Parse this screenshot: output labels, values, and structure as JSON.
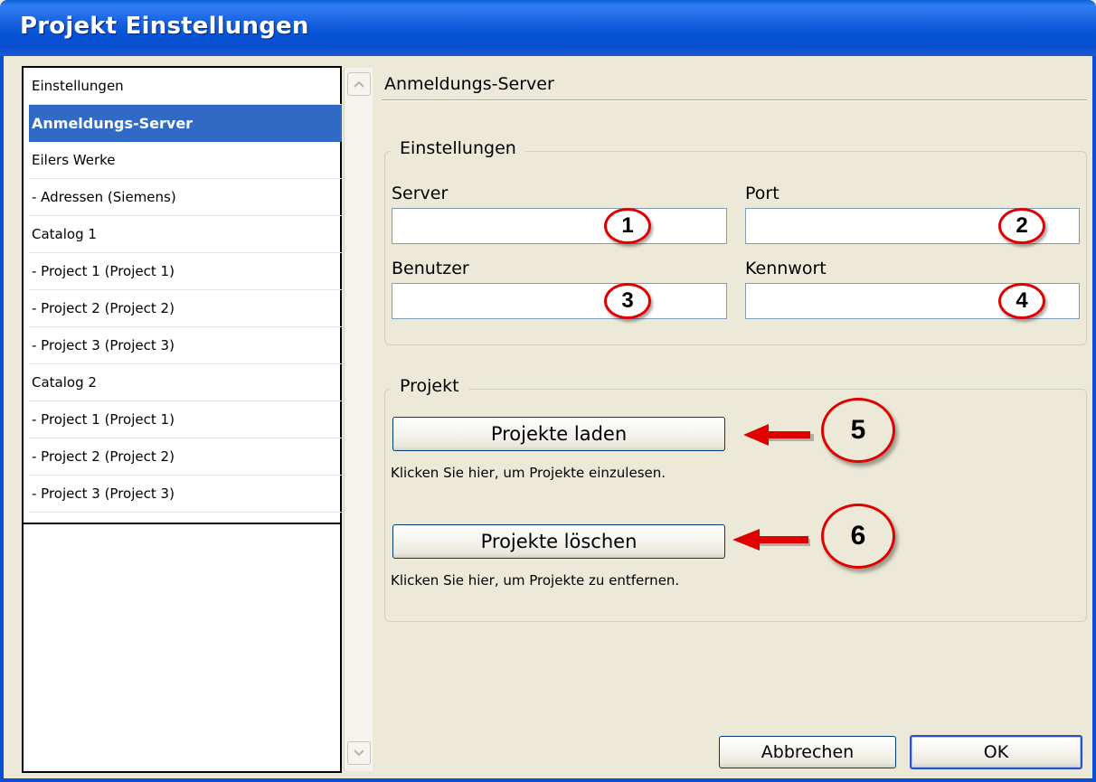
{
  "window": {
    "title": "Projekt Einstellungen"
  },
  "nav": {
    "items": [
      {
        "label": "Einstellungen"
      },
      {
        "label": "Anmeldungs-Server",
        "selected": true
      },
      {
        "label": "Eilers Werke"
      },
      {
        "label": " - Adressen (Siemens)"
      },
      {
        "label": "Catalog 1"
      },
      {
        "label": " - Project 1 (Project 1)"
      },
      {
        "label": " - Project 2 (Project 2)"
      },
      {
        "label": " - Project 3 (Project 3)"
      },
      {
        "label": "Catalog 2"
      },
      {
        "label": " - Project 1 (Project 1)"
      },
      {
        "label": " - Project 2 (Project 2)"
      },
      {
        "label": " - Project 3 (Project 3)"
      }
    ]
  },
  "page": {
    "title": "Anmeldungs-Server",
    "settings_group": {
      "legend": "Einstellungen",
      "server": {
        "label": "Server",
        "value": "",
        "marker": "1"
      },
      "port": {
        "label": "Port",
        "value": "",
        "marker": "2"
      },
      "user": {
        "label": "Benutzer",
        "value": "",
        "marker": "3"
      },
      "password": {
        "label": "Kennwort",
        "value": "",
        "marker": "4"
      }
    },
    "project_group": {
      "legend": "Projekt",
      "load_button": "Projekte laden",
      "load_hint": "Klicken Sie hier, um Projekte einzulesen.",
      "load_marker": "5",
      "delete_button": "Projekte löschen",
      "delete_hint": "Klicken Sie hier, um Projekte zu entfernen.",
      "delete_marker": "6"
    }
  },
  "footer": {
    "cancel": "Abbrechen",
    "ok": "OK"
  },
  "colors": {
    "titlebar": "#0a5fd8",
    "selection": "#316ac5",
    "annotation": "#e10000",
    "dialog_bg": "#ece9d8"
  }
}
